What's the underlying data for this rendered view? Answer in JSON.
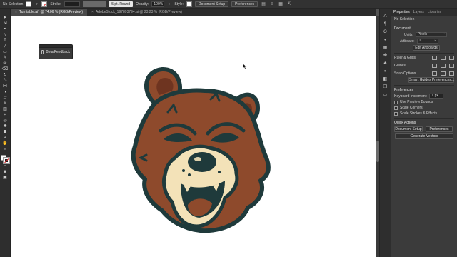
{
  "control_bar": {
    "selection": "No Selection",
    "stroke_label": "Stroke:",
    "brush": "5 pt. Round",
    "opacity_label": "Opacity:",
    "opacity_value": "100%",
    "style_label": "Style:",
    "document_setup": "Document Setup",
    "preferences": "Preferences"
  },
  "tabs": [
    {
      "label": "Turntable.ai* @ 74.06 % (RGB/Preview)",
      "active": true
    },
    {
      "label": "AdobeStock_197893794.ai @ 23.23 % (RGB/Preview)",
      "active": false
    }
  ],
  "beta": {
    "label": "Beta Feedback"
  },
  "panel": {
    "tabs": [
      "Properties",
      "Layers",
      "Libraries"
    ],
    "no_selection": "No Selection",
    "document_title": "Document",
    "units_label": "Units:",
    "units_value": "Pixels",
    "artboard_label": "Artboard:",
    "artboard_value": "1",
    "edit_artboards": "Edit Artboards",
    "rulers_grids": "Ruler & Grids",
    "guides": "Guides",
    "snap_options": "Snap Options",
    "smart_guides_btn": "Smart Guides Preferences...",
    "preferences_title": "Preferences",
    "keyboard_increment_label": "Keyboard Increment:",
    "keyboard_increment_value": "1 px",
    "use_preview_bounds": "Use Preview Bounds",
    "scale_corners": "Scale Corners",
    "scale_strokes": "Scale Strokes & Effects",
    "quick_actions": "Quick Actions",
    "document_setup": "Document Setup",
    "preferences_btn": "Preferences",
    "generate_vectors": "Generate Vectors"
  },
  "colors": {
    "fur": "#8e4a2c",
    "outline": "#1f3a3b",
    "cream": "#f3e2b8",
    "canvas": "#ffffff"
  }
}
